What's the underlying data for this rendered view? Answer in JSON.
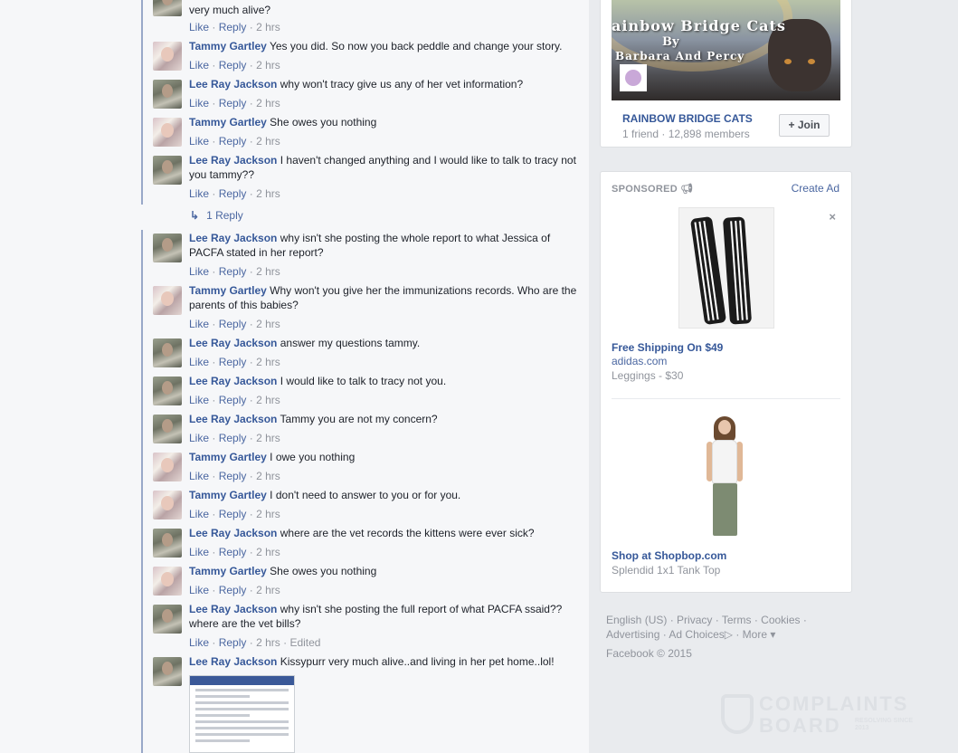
{
  "comments": [
    {
      "author": "",
      "text": "very much alive?",
      "author_type": "lee"
    },
    {
      "author": "Tammy Gartley",
      "text": "Yes you did. So now you back peddle and change your story.",
      "author_type": "tammy"
    },
    {
      "author": "Lee Ray Jackson",
      "text": "why won't tracy give us any of her vet information?",
      "author_type": "lee"
    },
    {
      "author": "Tammy Gartley",
      "text": "She owes you nothing",
      "author_type": "tammy"
    },
    {
      "author": "Lee Ray Jackson",
      "text": "I haven't changed anything and I would like to talk to tracy not you tammy??",
      "author_type": "lee"
    },
    {
      "author": "Lee Ray Jackson",
      "text": "why isn't she posting the whole report to what Jessica of PACFA stated in her report?",
      "author_type": "lee"
    },
    {
      "author": "Tammy Gartley",
      "text": "Why won't you give her the immunizations records. Who are the parents of this babies?",
      "author_type": "tammy"
    },
    {
      "author": "Lee Ray Jackson",
      "text": "answer my questions tammy.",
      "author_type": "lee"
    },
    {
      "author": "Lee Ray Jackson",
      "text": "I would like to talk to tracy not you.",
      "author_type": "lee"
    },
    {
      "author": "Lee Ray Jackson",
      "text": "Tammy you are not my concern?",
      "author_type": "lee"
    },
    {
      "author": "Tammy Gartley",
      "text": "I owe you nothing",
      "author_type": "tammy"
    },
    {
      "author": "Tammy Gartley",
      "text": "I don't need to answer to you or for you.",
      "author_type": "tammy"
    },
    {
      "author": "Lee Ray Jackson",
      "text": "where are the vet records the kittens were ever sick?",
      "author_type": "lee"
    },
    {
      "author": "Tammy Gartley",
      "text": "She owes you nothing",
      "author_type": "tammy"
    },
    {
      "author": "Lee Ray Jackson",
      "text": "why isn't she posting the full report of what PACFA ssaid?? where are the vet bills?",
      "author_type": "lee"
    },
    {
      "author": "Lee Ray Jackson",
      "text": "Kissypurr very much alive..and living in her pet home..lol!",
      "author_type": "lee"
    }
  ],
  "comment_actions": {
    "like": "Like",
    "reply": "Reply",
    "sep": "·",
    "time": "2 hrs",
    "edited": "Edited"
  },
  "reply_count": "1 Reply",
  "group": {
    "banner_line1": "ainbow Bridge Cats",
    "banner_line2": "By",
    "banner_line3": "Barbara And Percy",
    "name": "RAINBOW BRIDGE CATS",
    "meta": "1 friend · 12,898 members",
    "join_label": "Join",
    "join_icon": "+"
  },
  "ads": {
    "sponsored_label": "SPONSORED",
    "create_ad": "Create Ad",
    "close": "×",
    "items": [
      {
        "title": "Free Shipping On $49",
        "domain": "adidas.com",
        "desc": "Leggings - $30"
      },
      {
        "title": "Shop at Shopbop.com",
        "domain": "",
        "desc": "Splendid 1x1 Tank Top"
      }
    ]
  },
  "footer": {
    "links": [
      "English (US)",
      "Privacy",
      "Terms",
      "Cookies",
      "Advertising",
      "Ad Choices",
      "More"
    ],
    "copyright": "Facebook © 2015"
  },
  "watermark": {
    "line1": "COMPLAINTS",
    "line2": "BOARD",
    "tag": "RESOLVING SINCE 2013"
  }
}
